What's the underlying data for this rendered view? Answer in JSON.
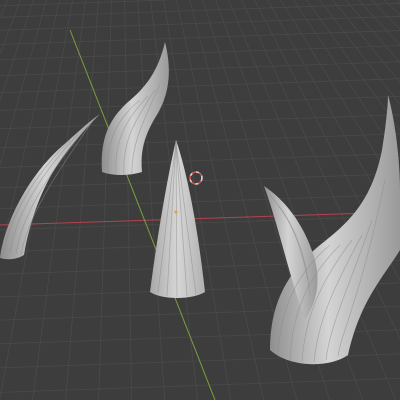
{
  "viewport": {
    "mode": "3d-viewport-solid-shading",
    "background_color": "#3d3d3d",
    "grid_color": "#4a4a4a",
    "x_axis_color": "#b3434d",
    "y_axis_color": "#7aa03c",
    "object_color": "#c9c9c9",
    "cursor_color": "#d8d8d8",
    "cursor_accent_color": "#d25050"
  },
  "objects": [
    {
      "name": "horn-left",
      "icon": "horn-mesh"
    },
    {
      "name": "horn-back",
      "icon": "horn-mesh"
    },
    {
      "name": "cone-center",
      "icon": "cone-mesh"
    },
    {
      "name": "horn-pair-right",
      "icon": "horn-mesh"
    }
  ],
  "cursor": {
    "icon": "3d-cursor-icon"
  }
}
